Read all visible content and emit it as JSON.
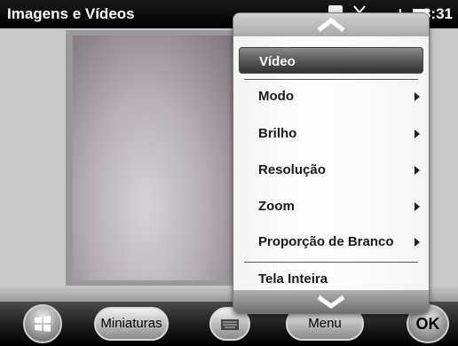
{
  "titlebar": {
    "title": "Imagens e Vídeos",
    "clock": "3:31",
    "icons": [
      "battery-icon",
      "antenna-icon",
      "signal-icon",
      "volume-icon"
    ]
  },
  "menu": {
    "items": [
      {
        "label": "Vídeo",
        "selected": true,
        "submenu": false
      },
      {
        "label": "Modo",
        "submenu": true
      },
      {
        "label": "Brilho",
        "submenu": true
      },
      {
        "label": "Resolução",
        "submenu": true
      },
      {
        "label": "Zoom",
        "submenu": true
      },
      {
        "label": "Proporção de Branco",
        "submenu": true
      },
      {
        "label": "Tela Inteira",
        "submenu": false
      }
    ]
  },
  "softkeys": {
    "left_label": "Miniaturas",
    "right_label": "Menu",
    "ok_label": "OK"
  },
  "colors": {
    "titlebar_bg": "#000000",
    "menu_selected": "#555555",
    "content_bg": "#c8c8c8"
  }
}
